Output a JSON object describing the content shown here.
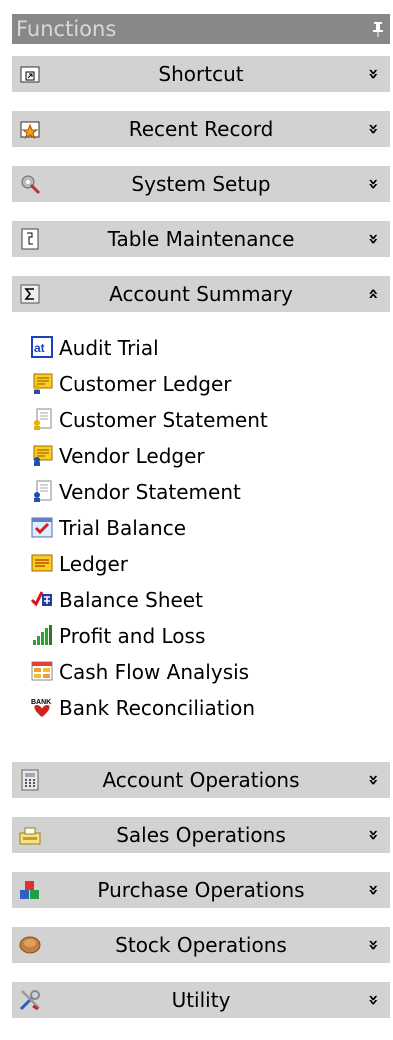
{
  "panel": {
    "title": "Functions",
    "pin_glyph": "ᵠ"
  },
  "sections_top": [
    {
      "label": "Shortcut",
      "icon": "shortcut-icon",
      "chevron": "»"
    },
    {
      "label": "Recent Record",
      "icon": "recent-record-icon",
      "chevron": "»"
    },
    {
      "label": "System Setup",
      "icon": "system-setup-icon",
      "chevron": "»"
    },
    {
      "label": "Table Maintenance",
      "icon": "table-maintenance-icon",
      "chevron": "»"
    },
    {
      "label": "Account Summary",
      "icon": "sigma-icon",
      "chevron": "«",
      "expanded": true
    }
  ],
  "account_summary_items": [
    {
      "label": "Audit Trial",
      "icon": "audit-trial-icon"
    },
    {
      "label": "Customer Ledger",
      "icon": "customer-ledger-icon"
    },
    {
      "label": "Customer Statement",
      "icon": "customer-statement-icon"
    },
    {
      "label": "Vendor Ledger",
      "icon": "vendor-ledger-icon"
    },
    {
      "label": "Vendor Statement",
      "icon": "vendor-statement-icon"
    },
    {
      "label": "Trial Balance",
      "icon": "trial-balance-icon"
    },
    {
      "label": "Ledger",
      "icon": "ledger-icon"
    },
    {
      "label": "Balance Sheet",
      "icon": "balance-sheet-icon"
    },
    {
      "label": "Profit and Loss",
      "icon": "profit-loss-icon"
    },
    {
      "label": "Cash Flow Analysis",
      "icon": "cash-flow-icon"
    },
    {
      "label": "Bank Reconciliation",
      "icon": "bank-reconciliation-icon"
    }
  ],
  "sections_bottom": [
    {
      "label": "Account Operations",
      "icon": "account-operations-icon",
      "chevron": "»"
    },
    {
      "label": "Sales Operations",
      "icon": "sales-operations-icon",
      "chevron": "»"
    },
    {
      "label": "Purchase Operations",
      "icon": "purchase-operations-icon",
      "chevron": "»"
    },
    {
      "label": "Stock Operations",
      "icon": "stock-operations-icon",
      "chevron": "»"
    },
    {
      "label": "Utility",
      "icon": "utility-icon",
      "chevron": "»"
    }
  ],
  "colors": {
    "titlebar": "#888888",
    "header": "#d2d2d2"
  }
}
